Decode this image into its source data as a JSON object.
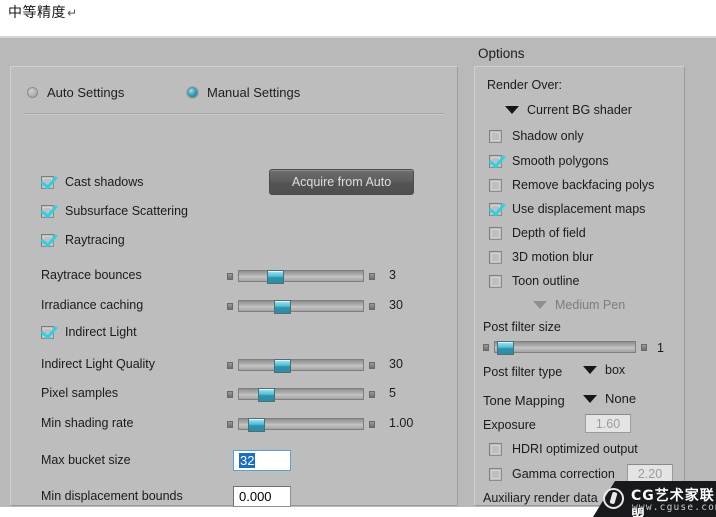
{
  "caption": {
    "text": "中等精度",
    "pilcrow": "↵"
  },
  "mode": {
    "auto_label": "Auto Settings",
    "manual_label": "Manual Settings",
    "selected": "Manual Settings"
  },
  "acquire_button": {
    "label": "Acquire from Auto"
  },
  "left_checks": [
    {
      "label": "Cast shadows",
      "checked": true
    },
    {
      "label": "Subsurface Scattering",
      "checked": true
    },
    {
      "label": "Raytracing",
      "checked": true
    }
  ],
  "indirect_light": {
    "label": "Indirect Light",
    "checked": true
  },
  "sliders": [
    {
      "label": "Raytrace bounces",
      "value": "3",
      "pos_pct": 26
    },
    {
      "label": "Irradiance caching",
      "value": "30",
      "pos_pct": 33
    },
    {
      "label": "Indirect Light Quality",
      "value": "30",
      "pos_pct": 33
    },
    {
      "label": "Pixel samples",
      "value": "5",
      "pos_pct": 18
    },
    {
      "label": "Min shading rate",
      "value": "1.00",
      "pos_pct": 8
    }
  ],
  "fields": [
    {
      "label": "Max bucket size",
      "value": "32",
      "selected": true
    },
    {
      "label": "Min displacement bounds",
      "value": "0.000",
      "selected": false
    }
  ],
  "options": {
    "title": "Options",
    "render_over_label": "Render Over:",
    "render_over_value": "Current BG shader",
    "checks": [
      {
        "label": "Shadow only",
        "checked": false
      },
      {
        "label": "Smooth polygons",
        "checked": true
      },
      {
        "label": "Remove backfacing polys",
        "checked": false
      },
      {
        "label": "Use displacement maps",
        "checked": true
      },
      {
        "label": "Depth of field",
        "checked": false
      },
      {
        "label": "3D motion blur",
        "checked": false
      },
      {
        "label": "Toon outline",
        "checked": false
      }
    ],
    "pen_value": "Medium Pen",
    "post_filter_size_label": "Post filter size",
    "post_filter_size_value": "1",
    "post_filter_size_pos_pct": 2,
    "post_filter_type_label": "Post filter type",
    "post_filter_type_value": "box",
    "tone_mapping_label": "Tone Mapping",
    "tone_mapping_value": "None",
    "exposure_label": "Exposure",
    "exposure_value": "1.60",
    "hdri_label": "HDRI optimized output",
    "hdri_checked": false,
    "gamma_label": "Gamma correction",
    "gamma_checked": false,
    "gamma_value": "2.20",
    "aux_label": "Auxiliary render data"
  },
  "watermark": {
    "cn": "CG艺术家联盟",
    "url": "www.cguse.com"
  },
  "colors": {
    "panel_bg": "#bdbdbd",
    "window_bg": "#b9b9b9",
    "accent_cyan": "#2fd0e0",
    "thumb_teal": "#4fbcd4",
    "selection_blue": "#1c6ec4"
  }
}
